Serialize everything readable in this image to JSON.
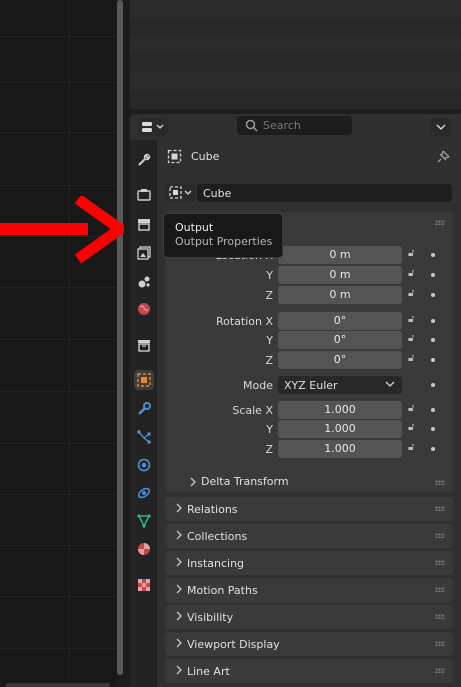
{
  "header": {
    "search_placeholder": "Search"
  },
  "context": {
    "object_name": "Cube",
    "object_field_value": "Cube"
  },
  "tooltip": {
    "title": "Output",
    "subtitle": "Output Properties"
  },
  "transform": {
    "location_label": "Location X",
    "loc_y_label": "Y",
    "loc_z_label": "Z",
    "location": [
      "0 m",
      "0 m",
      "0 m"
    ],
    "rotation_label": "Rotation X",
    "rot_y_label": "Y",
    "rot_z_label": "Z",
    "rotation": [
      "0°",
      "0°",
      "0°"
    ],
    "mode_label": "Mode",
    "mode_value": "XYZ Euler",
    "scale_label": "Scale X",
    "scale_y_label": "Y",
    "scale_z_label": "Z",
    "scale": [
      "1.000",
      "1.000",
      "1.000"
    ],
    "delta_label": "Delta Transform"
  },
  "panels": [
    "Relations",
    "Collections",
    "Instancing",
    "Motion Paths",
    "Visibility",
    "Viewport Display",
    "Line Art"
  ],
  "tabs": [
    "tool-icon",
    "render-icon",
    "output-icon",
    "view-layer-icon",
    "scene-icon",
    "world-icon",
    "collection-icon",
    "object-icon",
    "modifier-icon",
    "particles-icon",
    "physics-icon",
    "constraints-icon",
    "data-icon",
    "material-icon",
    "texture-icon"
  ],
  "colors": {
    "accent_orange": "#e8892b",
    "arrow_red": "#ff0000",
    "panel_bg": "#3a3a3a",
    "field_bg": "#545454"
  }
}
